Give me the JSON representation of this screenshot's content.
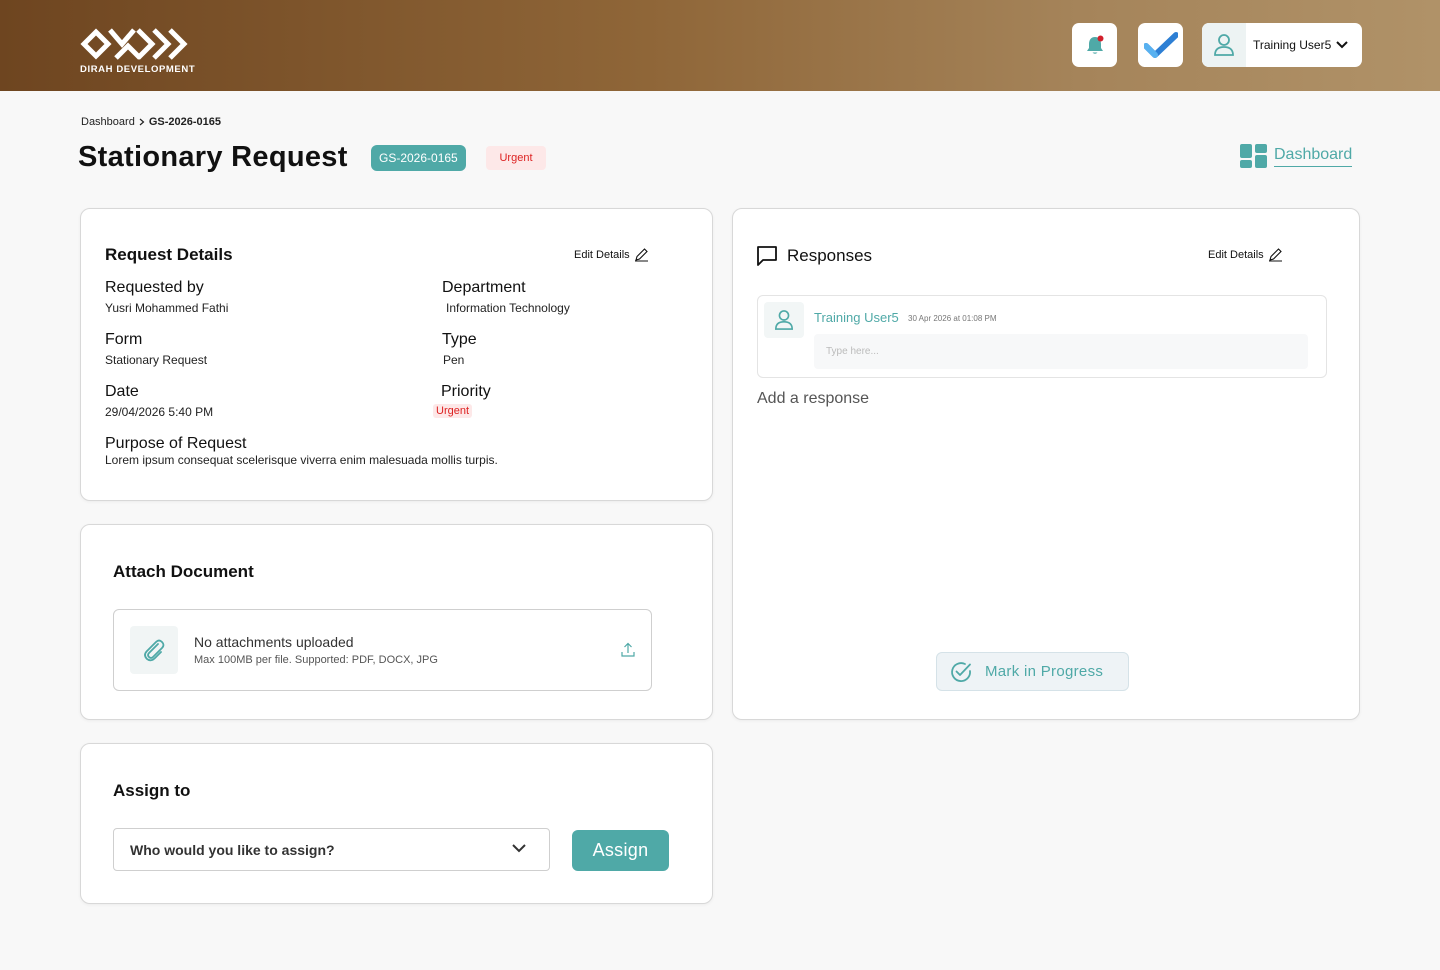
{
  "header": {
    "logo_text": "DIRAH DEVELOPMENT",
    "user_name": "Training User5"
  },
  "breadcrumb": {
    "root": "Dashboard",
    "current": "GS-2026-0165"
  },
  "page": {
    "title": "Stationary Request",
    "id_badge": "GS-2026-0165",
    "priority_badge": "Urgent",
    "dashboard_link": "Dashboard"
  },
  "request_details": {
    "title": "Request Details",
    "edit_label": "Edit Details",
    "requested_by_label": "Requested by",
    "requested_by": "Yusri Mohammed Fathi",
    "department_label": "Department",
    "department": "Information Technology",
    "form_label": "Form",
    "form": "Stationary Request",
    "type_label": "Type",
    "type": "Pen",
    "date_label": "Date",
    "date": "29/04/2026 5:40 PM",
    "priority_label": "Priority",
    "priority": "Urgent",
    "purpose_label": "Purpose of Request",
    "purpose": "Lorem ipsum consequat scelerisque viverra enim malesuada mollis turpis."
  },
  "attach": {
    "title": "Attach Document",
    "empty_title": "No attachments uploaded",
    "hint": "Max 100MB per file. Supported: PDF, DOCX, JPG"
  },
  "assign": {
    "title": "Assign to",
    "placeholder": "Who would you like to assign?",
    "button": "Assign"
  },
  "responses": {
    "title": "Responses",
    "edit_label": "Edit Details",
    "item_user": "Training User5",
    "item_time": "30 Apr 2026 at 01:08 PM",
    "input_placeholder": "Type here...",
    "add_response": "Add a response",
    "mark_button": "Mark in Progress"
  },
  "colors": {
    "accent": "#4fa9a7",
    "urgent": "#dd2222",
    "urgent_bg": "#fde8e8",
    "header_start": "#6e4520",
    "header_end": "#b09268"
  }
}
